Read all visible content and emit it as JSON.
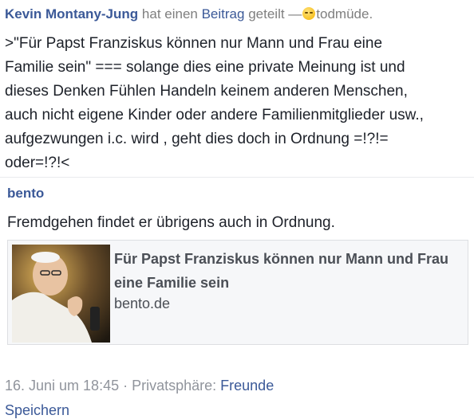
{
  "header": {
    "author": "Kevin Montany-Jung",
    "verb_prefix": "hat einen",
    "object": "Beitrag",
    "verb_suffix": "geteilt —",
    "feeling": "todmüde."
  },
  "post": {
    "lines": [
      ">\"Für Papst Franziskus können nur Mann und Frau eine",
      "Familie sein\" === solange dies eine private Meinung ist und",
      "dieses Denken Fühlen Handeln keinem anderen Menschen,",
      "auch nicht eigene Kinder oder andere Familienmitglieder usw.,",
      "aufgezwungen i.c. wird , geht dies doch in Ordnung =!?!=",
      "oder=!?!<"
    ]
  },
  "shared": {
    "source": "bento",
    "text": "Fremdgehen findet er übrigens auch in Ordnung.",
    "card": {
      "title": "Für Papst Franziskus können nur Mann und Frau eine Familie sein",
      "domain": "bento.de"
    }
  },
  "footer": {
    "date": "16. Juni um 18:45 · Privatsphäre:",
    "privacy": "Freunde",
    "action": "Speichern"
  }
}
